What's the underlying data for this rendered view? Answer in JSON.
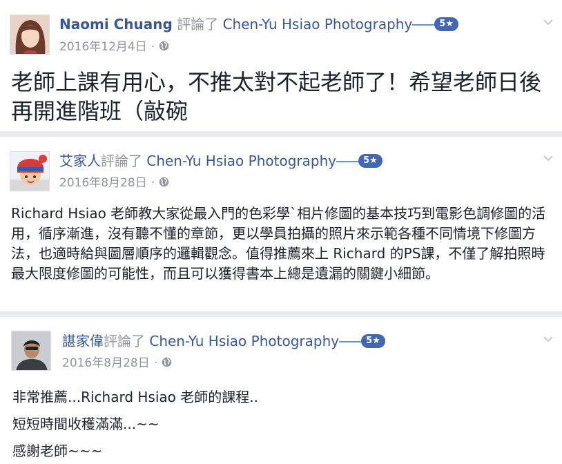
{
  "verb": "評論了",
  "page_name": "Chen-Yu Hsiao Photography",
  "rating_badge": "5★",
  "privacy_sep": "·",
  "posts": [
    {
      "author": "Naomi Chuang",
      "date": "2016年12月4日",
      "paragraphs": [
        "老師上課有用心，不推太對不起老師了！希望老師日後再開進階班（敲碗"
      ]
    },
    {
      "author": "艾家人",
      "date": "2016年8月28日",
      "paragraphs": [
        "Richard Hsiao 老師教大家從最入門的色彩學`相片修圖的基本技巧到電影色調修圖的活用，循序漸進，沒有聽不懂的章節，更以學員拍攝的照片來示範各種不同情境下修圖方法，也適時給與圖層順序的邏輯觀念。值得推薦來上 Richard 的PS課，不僅了解拍照時最大限度修圖的可能性，而且可以獲得書本上總是遺漏的關鍵小細節。"
      ]
    },
    {
      "author": "諶家偉",
      "date": "2016年8月28日",
      "paragraphs": [
        "非常推薦...Richard Hsiao 老師的課程..",
        "短短時間收穫滿滿...~~",
        "感謝老師~~~"
      ]
    }
  ]
}
